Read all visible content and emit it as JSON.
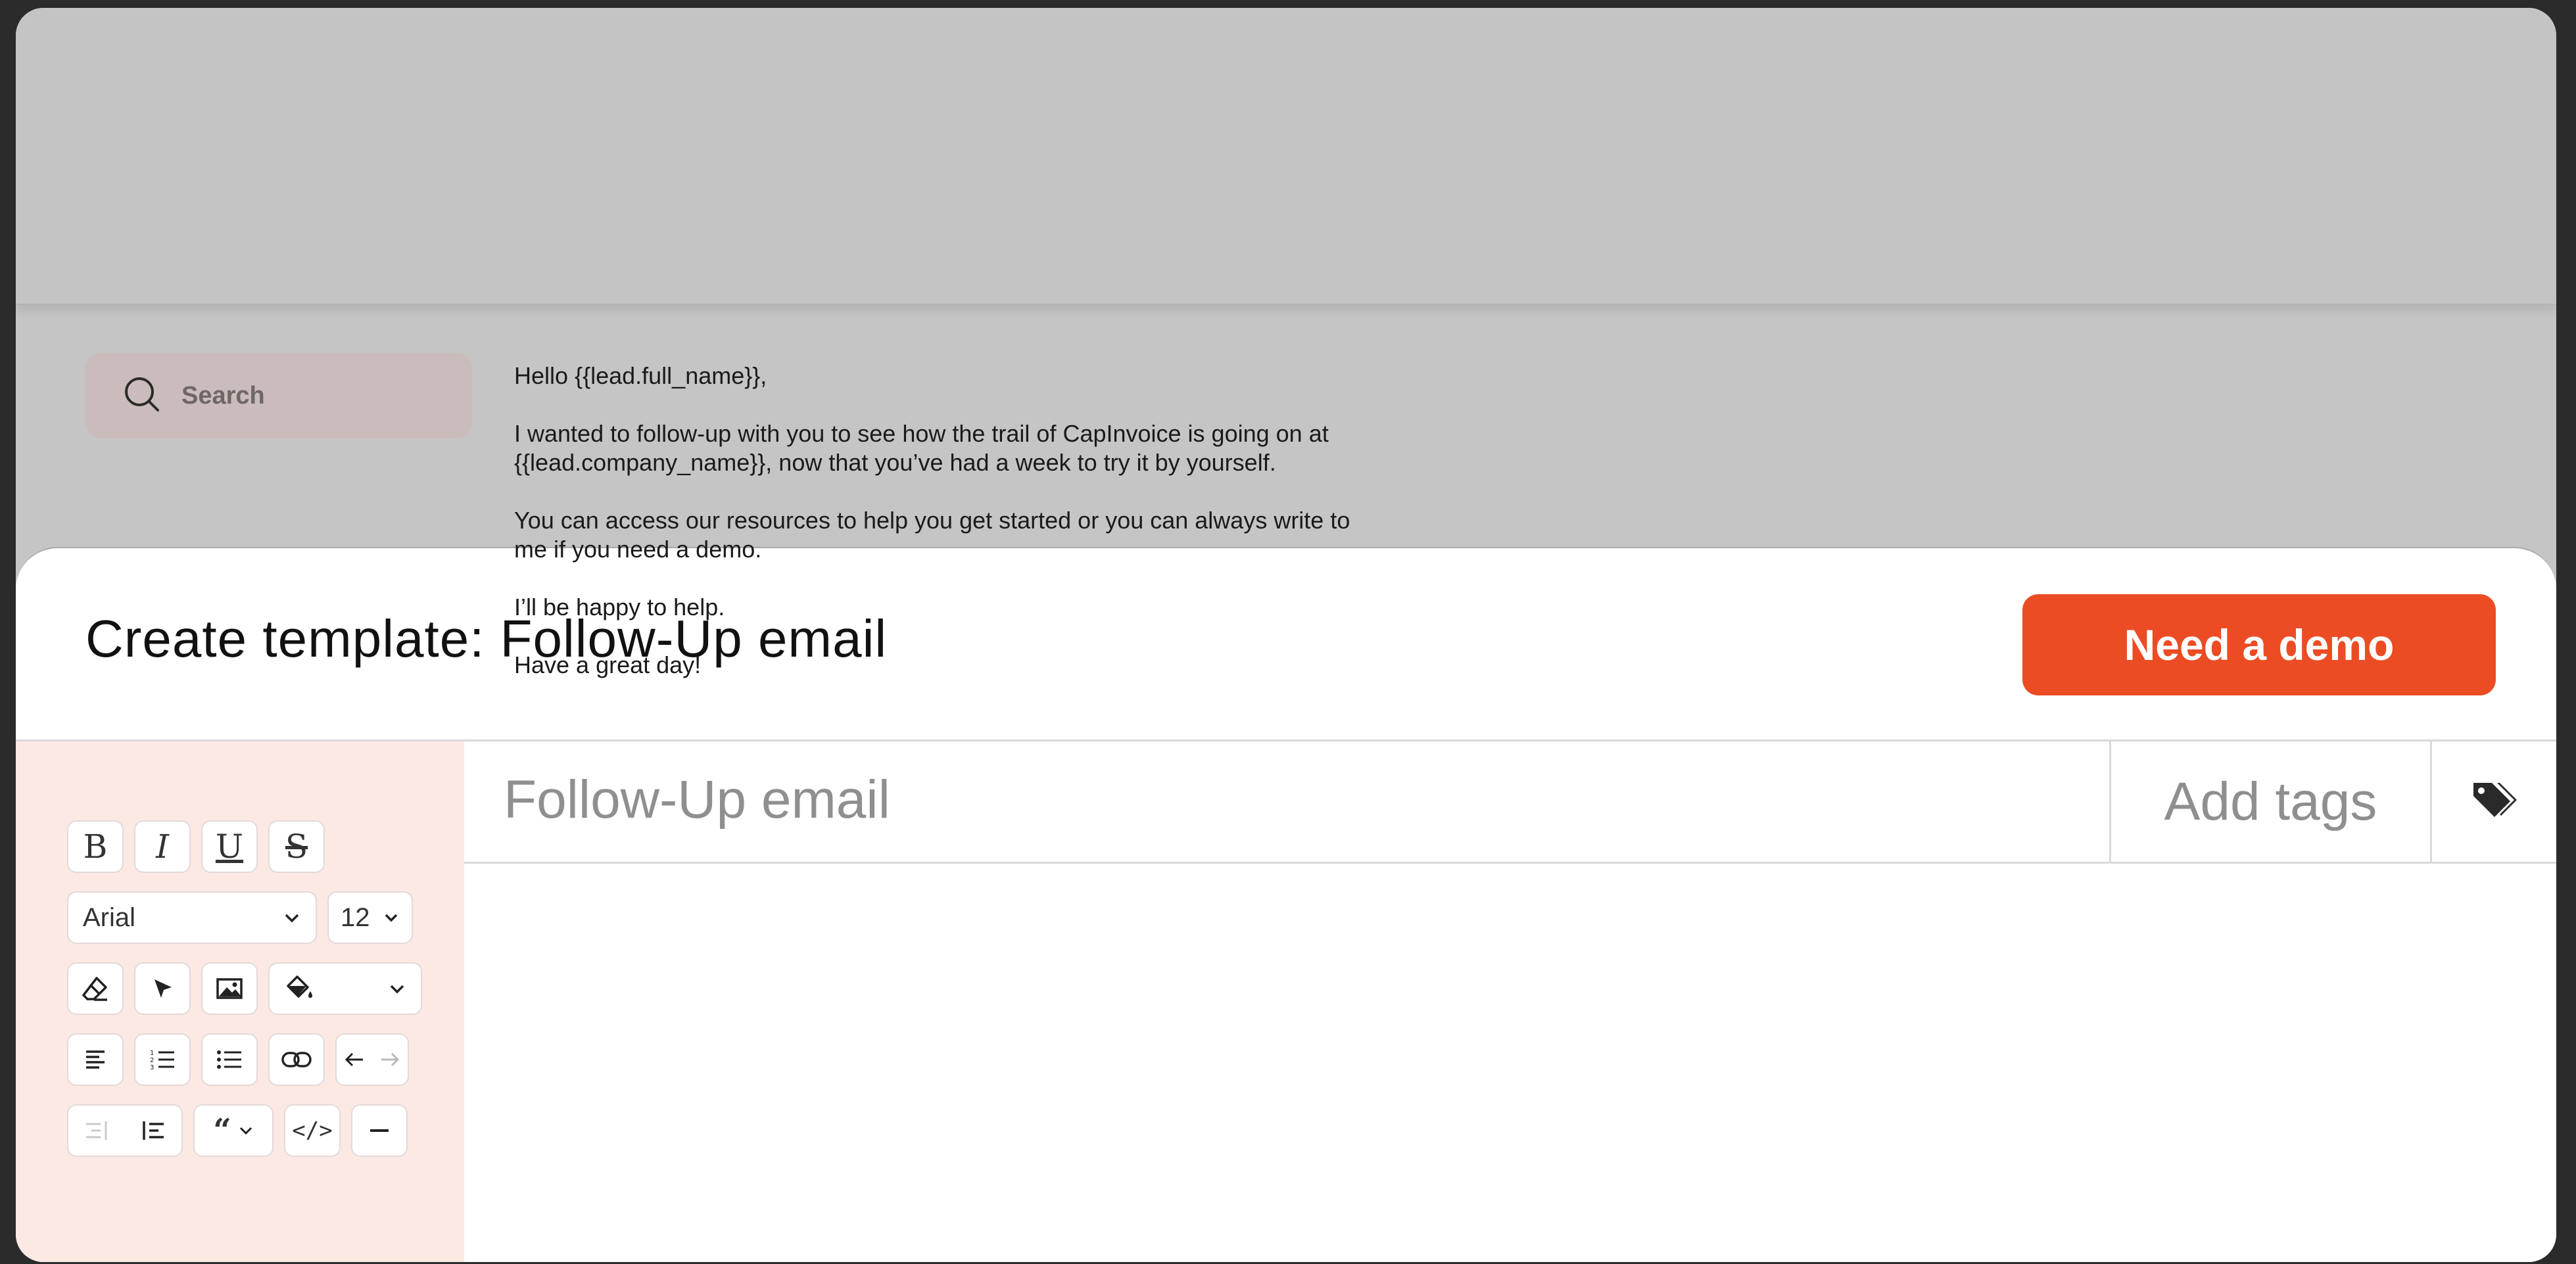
{
  "search": {
    "placeholder": "Search"
  },
  "modal": {
    "title": "Create template: Follow-Up email",
    "demo_button": "Need a demo"
  },
  "editor": {
    "subject": "Follow-Up email",
    "tags_placeholder": "Add tags",
    "toolbar": {
      "bold": "B",
      "italic": "I",
      "underline": "U",
      "strike": "S",
      "font_family": "Arial",
      "font_size": "12",
      "quote": "“",
      "code": "</>"
    },
    "body": {
      "greeting": "Hello {{lead.full_name}},",
      "p1_line1": "I wanted to follow-up with you to see how the trail of CapInvoice is going on at",
      "p1_line2": "{{lead.company_name}}, now that you’ve had a week to try it by yourself.",
      "p2_line1": "You can access our resources to help you get started or you can always write to",
      "p2_line2": "me if you need a demo.",
      "p3": "I’ll be happy to help.",
      "p4": "Have a great day!"
    }
  },
  "colors": {
    "accent": "#ec4c24",
    "sidebar_bg": "#fde9e4",
    "overlay": "#c5c5c5"
  },
  "icons": [
    "search-icon",
    "eraser-icon",
    "cursor-icon",
    "image-icon",
    "fill-color-icon",
    "chevron-down-icon",
    "align-left-icon",
    "ordered-list-icon",
    "bullet-list-icon",
    "link-icon",
    "undo-icon",
    "redo-icon",
    "indent-icon",
    "outdent-icon",
    "quote-icon",
    "code-icon",
    "horizontal-rule-icon",
    "tags-icon"
  ]
}
